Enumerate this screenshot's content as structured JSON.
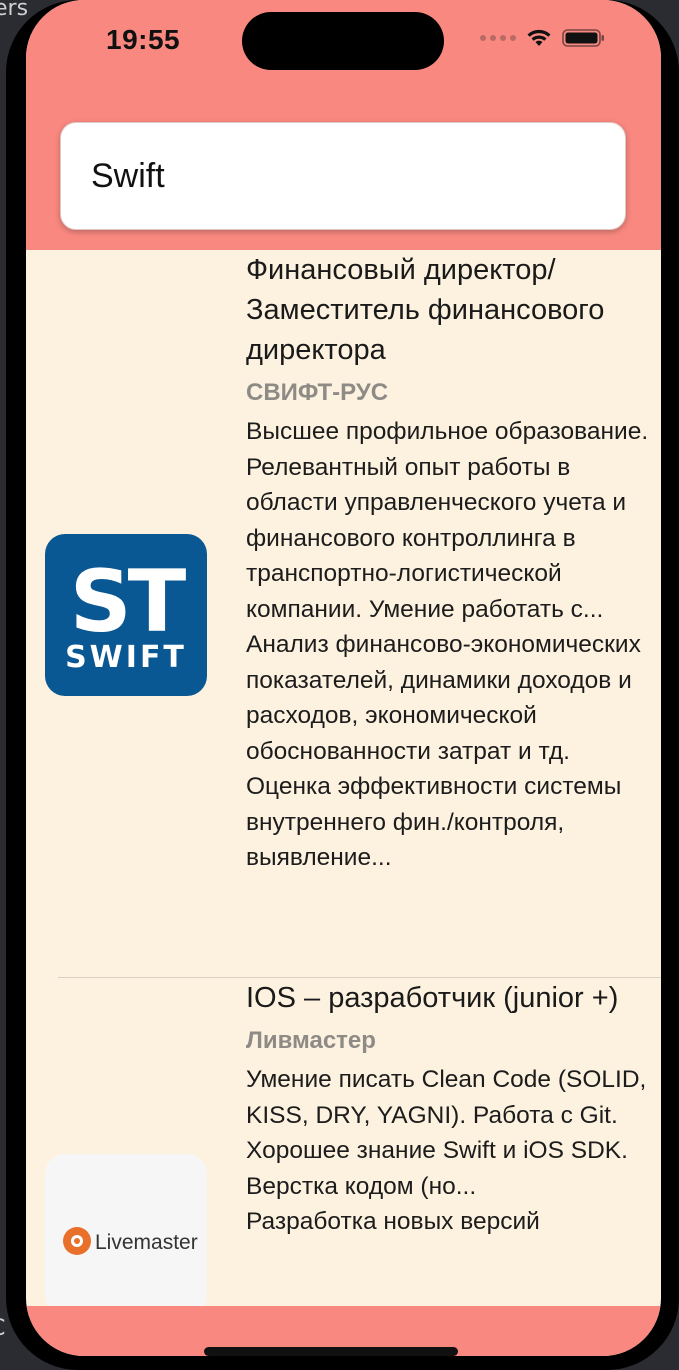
{
  "edge_left_top": "ers",
  "edge_left_bottom": "C",
  "status_bar": {
    "time": "19:55"
  },
  "search": {
    "value": "Swift",
    "placeholder": ""
  },
  "vacancies": [
    {
      "title": "Финансовый директор/ Заместитель финансового директора",
      "company": "СВИФТ-РУС",
      "requirements": "Высшее профильное образование. Релевантный опыт работы в области управленческого учета и финансового контроллинга в транспортно-логистической компании. Умение работать с...",
      "responsibilities": "Анализ финансово-экономических показателей, динамики доходов и расходов, экономической обоснованности затрат и тд. Оценка эффективности системы внутреннего фин./контроля, выявление...",
      "logo": {
        "top": "ST",
        "bottom": "SWIFT",
        "color": "#0a5893"
      }
    },
    {
      "title": "IOS – разработчик (junior +)",
      "company": "Ливмастер",
      "requirements": "Умение писать Clean Code (SOLID, KISS, DRY, YAGNI). Работа с Git. Хорошее знание Swift и iOS SDK. Верстка кодом (но...",
      "responsibilities": "Разработка новых версий",
      "logo": {
        "text": "Livemaster",
        "icon": "flower-icon",
        "color": "#e8702a"
      }
    }
  ],
  "colors": {
    "header": "#f98880",
    "list_bg": "#fdf2e0",
    "company_text": "#8e8a86"
  }
}
